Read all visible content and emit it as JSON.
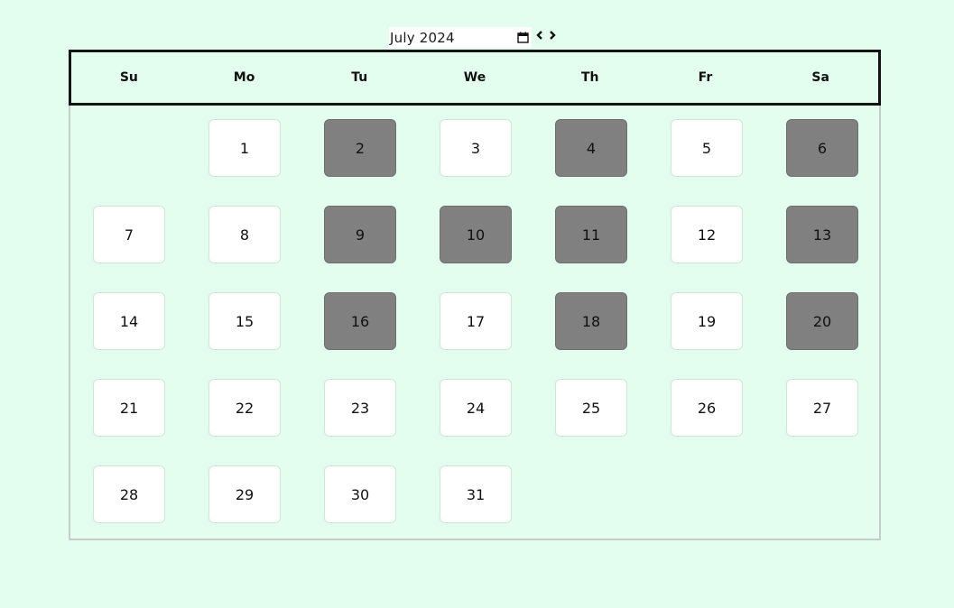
{
  "month_picker": {
    "value": "July 2024",
    "icon": "calendar-icon"
  },
  "nav": {
    "prev_icon": "chevron-left-icon",
    "next_icon": "chevron-right-icon"
  },
  "weekdays": [
    "Su",
    "Mo",
    "Tu",
    "We",
    "Th",
    "Fr",
    "Sa"
  ],
  "first_weekday_index": 1,
  "days": [
    {
      "label": "1",
      "state": "free"
    },
    {
      "label": "2",
      "state": "booked"
    },
    {
      "label": "3",
      "state": "free"
    },
    {
      "label": "4",
      "state": "booked"
    },
    {
      "label": "5",
      "state": "free"
    },
    {
      "label": "6",
      "state": "booked"
    },
    {
      "label": "7",
      "state": "free"
    },
    {
      "label": "8",
      "state": "free"
    },
    {
      "label": "9",
      "state": "booked"
    },
    {
      "label": "10",
      "state": "booked"
    },
    {
      "label": "11",
      "state": "booked"
    },
    {
      "label": "12",
      "state": "free"
    },
    {
      "label": "13",
      "state": "booked"
    },
    {
      "label": "14",
      "state": "free"
    },
    {
      "label": "15",
      "state": "free"
    },
    {
      "label": "16",
      "state": "booked"
    },
    {
      "label": "17",
      "state": "free"
    },
    {
      "label": "18",
      "state": "booked"
    },
    {
      "label": "19",
      "state": "free"
    },
    {
      "label": "20",
      "state": "booked"
    },
    {
      "label": "21",
      "state": "free"
    },
    {
      "label": "22",
      "state": "free"
    },
    {
      "label": "23",
      "state": "free"
    },
    {
      "label": "24",
      "state": "free"
    },
    {
      "label": "25",
      "state": "free"
    },
    {
      "label": "26",
      "state": "free"
    },
    {
      "label": "27",
      "state": "free"
    },
    {
      "label": "28",
      "state": "free"
    },
    {
      "label": "29",
      "state": "free"
    },
    {
      "label": "30",
      "state": "free"
    },
    {
      "label": "31",
      "state": "free"
    }
  ],
  "colors": {
    "background": "#e3fdee",
    "free_day": "#ffffff",
    "booked_day": "#808080",
    "header_border": "#141414"
  }
}
